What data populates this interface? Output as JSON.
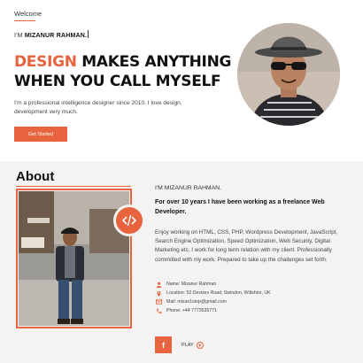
{
  "hero": {
    "welcome": "Welcome",
    "greeting_prefix": "I'M",
    "greeting_name": "MIZANUR RAHMAN.",
    "headline_accent": "DESIGN",
    "headline_rest1": " MAKES ANYTHING",
    "headline_line2": "WHEN YOU CALL MYSELF",
    "intro": "I'm a professional intelligence designer since 2010. I love design, development very much.",
    "cta_label": "Get Started"
  },
  "about": {
    "title": "About",
    "name_tag": "I'M MIZANUR RAHMAN.",
    "experience": "For over 10 years I have been working as a freelance Web Developer.",
    "description": "Enjoy working on HTML, CSS, PHP, Wordpress Development, JavaScript, Search Engine Optimization, Speed Optimization, Web Security, Digital Marketing etc. I work for long term relation with my client. Professionally committed with my work. Prepared to take up the challenges set forth.",
    "info": [
      {
        "icon": "user-icon",
        "text": "Name: Mizanur Rahman"
      },
      {
        "icon": "location-pin-icon",
        "text": "Location: 52 Devizes Road, Swindon, Wiltshire, UK"
      },
      {
        "icon": "mail-icon",
        "text": "Mail: mizan1stop@gmail.com"
      },
      {
        "icon": "phone-icon",
        "text": "Phone: +44 7773535771"
      }
    ],
    "facebook_label": "f",
    "play_label": "PLAY",
    "code_badge": "</>"
  },
  "colors": {
    "accent": "#e8643f",
    "section_bg": "#f4f3f1"
  }
}
